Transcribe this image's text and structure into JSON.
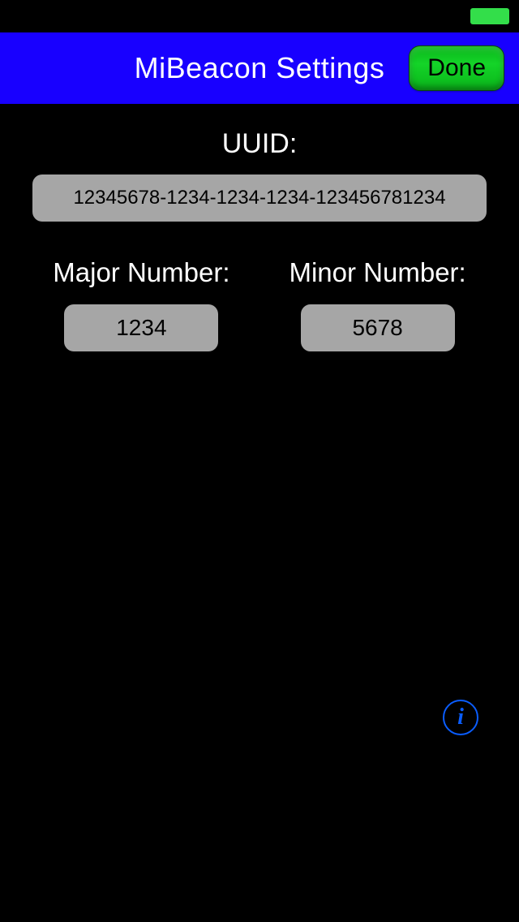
{
  "nav": {
    "title": "MiBeacon Settings",
    "done_label": "Done"
  },
  "fields": {
    "uuid": {
      "label": "UUID:",
      "value": "12345678-1234-1234-1234-123456781234"
    },
    "major": {
      "label": "Major Number:",
      "value": "1234"
    },
    "minor": {
      "label": "Minor Number:",
      "value": "5678"
    }
  },
  "info": {
    "glyph": "i"
  }
}
